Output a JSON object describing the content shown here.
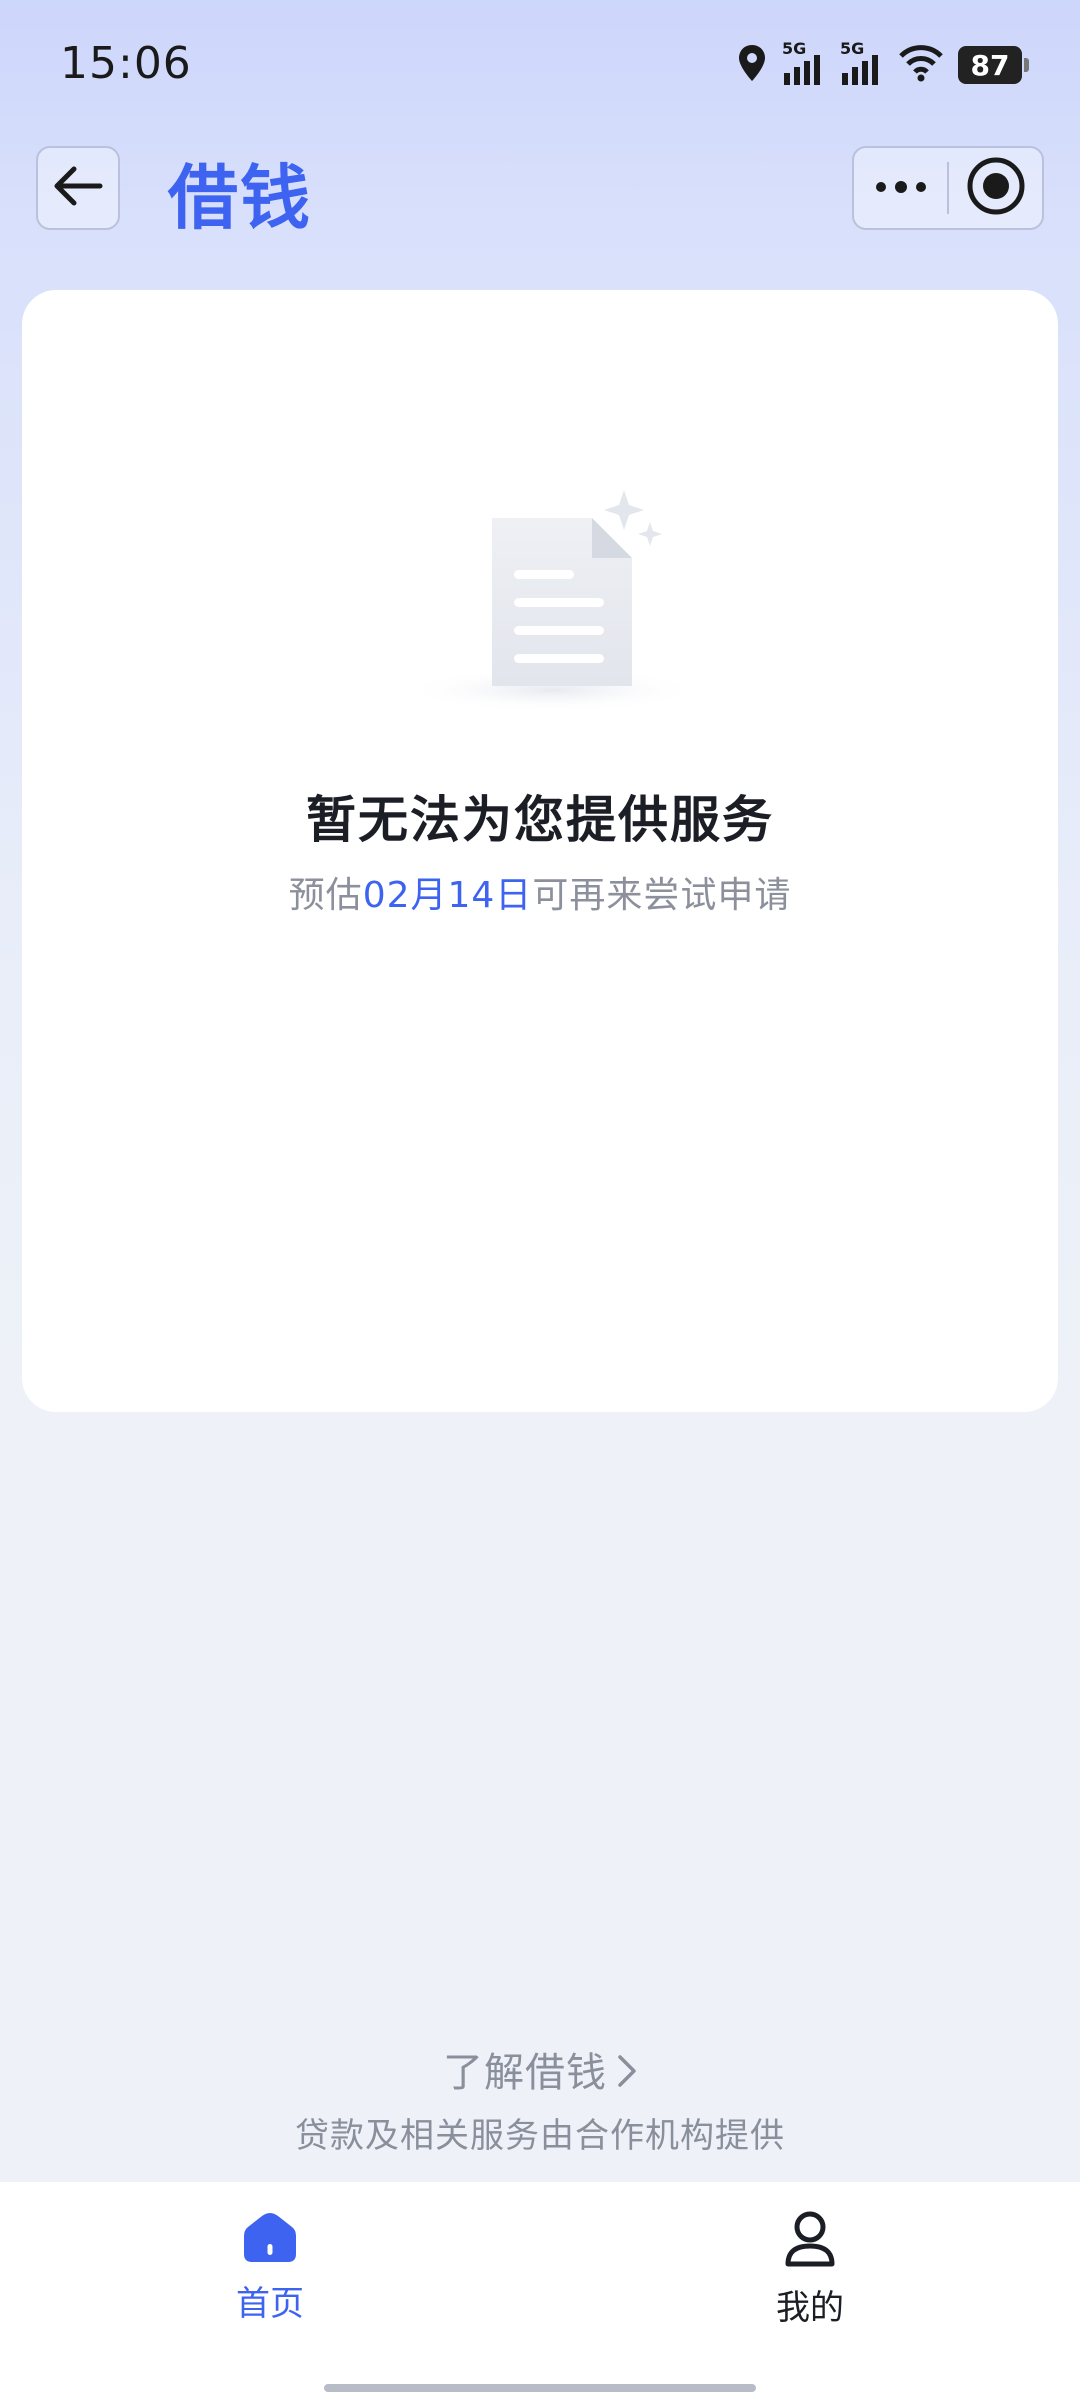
{
  "status_bar": {
    "time": "15:06",
    "battery": "87",
    "signal_1_label": "5G",
    "signal_2_label": "5G"
  },
  "nav": {
    "title": "借钱",
    "back_icon": "arrow-left-icon",
    "more_icon": "ellipsis-icon",
    "close_icon": "target-circle-icon"
  },
  "empty_state": {
    "icon": "document-icon",
    "title": "暂无法为您提供服务",
    "subtitle_prefix": "预估",
    "subtitle_date": "02月14日",
    "subtitle_suffix": "可再来尝试申请"
  },
  "footer": {
    "learn_more": "了解借钱",
    "disclaimer": "贷款及相关服务由合作机构提供"
  },
  "tab_bar": {
    "home_label": "首页",
    "mine_label": "我的"
  },
  "colors": {
    "accent": "#3d63f0",
    "title_text": "#1c1e26",
    "muted_text": "#8c909c"
  }
}
